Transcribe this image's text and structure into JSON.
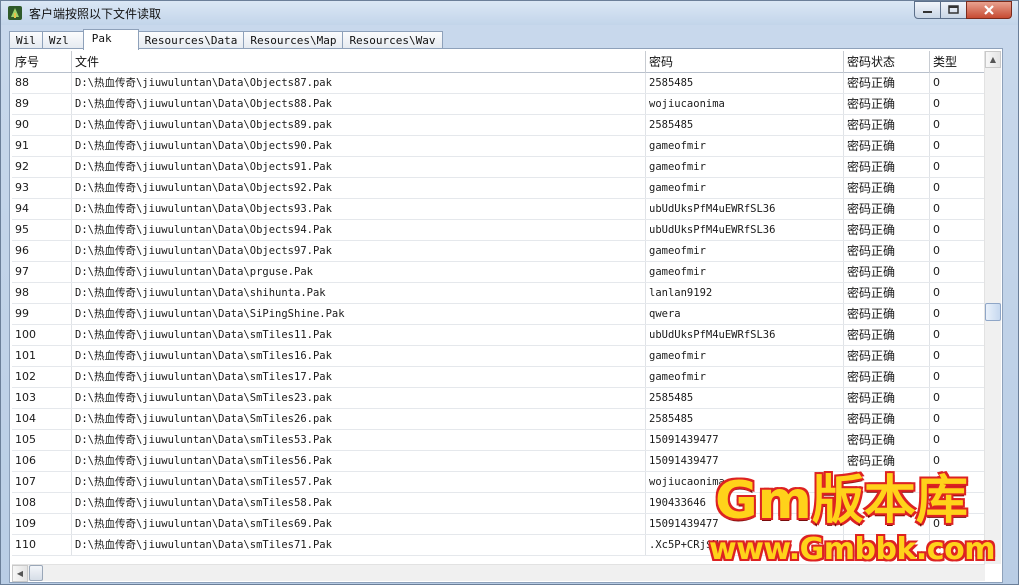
{
  "window": {
    "title": "客户端按照以下文件读取",
    "app_icon": "mir-legend-app-icon",
    "controls": [
      "minimize-icon",
      "maximize-icon",
      "close-icon"
    ]
  },
  "tabs": [
    {
      "label": "Wil",
      "active": false
    },
    {
      "label": "Wzl",
      "active": false
    },
    {
      "label": "Pak",
      "active": true
    },
    {
      "label": "Resources\\Data",
      "active": false
    },
    {
      "label": "Resources\\Map",
      "active": false
    },
    {
      "label": "Resources\\Wav",
      "active": false
    }
  ],
  "table": {
    "columns": [
      "序号",
      "文件",
      "密码",
      "密码状态",
      "类型"
    ],
    "rows": [
      [
        "88",
        "D:\\热血传奇\\jiuwuluntan\\Data\\Objects87.pak",
        "2585485",
        "密码正确",
        "0"
      ],
      [
        "89",
        "D:\\热血传奇\\jiuwuluntan\\Data\\Objects88.Pak",
        "wojiucaonima",
        "密码正确",
        "0"
      ],
      [
        "90",
        "D:\\热血传奇\\jiuwuluntan\\Data\\Objects89.pak",
        "2585485",
        "密码正确",
        "0"
      ],
      [
        "91",
        "D:\\热血传奇\\jiuwuluntan\\Data\\Objects90.Pak",
        "gameofmir",
        "密码正确",
        "0"
      ],
      [
        "92",
        "D:\\热血传奇\\jiuwuluntan\\Data\\Objects91.Pak",
        "gameofmir",
        "密码正确",
        "0"
      ],
      [
        "93",
        "D:\\热血传奇\\jiuwuluntan\\Data\\Objects92.Pak",
        "gameofmir",
        "密码正确",
        "0"
      ],
      [
        "94",
        "D:\\热血传奇\\jiuwuluntan\\Data\\Objects93.Pak",
        "ubUdUksPfM4uEWRfSL36",
        "密码正确",
        "0"
      ],
      [
        "95",
        "D:\\热血传奇\\jiuwuluntan\\Data\\Objects94.Pak",
        "ubUdUksPfM4uEWRfSL36",
        "密码正确",
        "0"
      ],
      [
        "96",
        "D:\\热血传奇\\jiuwuluntan\\Data\\Objects97.Pak",
        "gameofmir",
        "密码正确",
        "0"
      ],
      [
        "97",
        "D:\\热血传奇\\jiuwuluntan\\Data\\prguse.Pak",
        "gameofmir",
        "密码正确",
        "0"
      ],
      [
        "98",
        "D:\\热血传奇\\jiuwuluntan\\Data\\shihunta.Pak",
        "lanlan9192",
        "密码正确",
        "0"
      ],
      [
        "99",
        "D:\\热血传奇\\jiuwuluntan\\Data\\SiPingShine.Pak",
        "qwera",
        "密码正确",
        "0"
      ],
      [
        "100",
        "D:\\热血传奇\\jiuwuluntan\\Data\\smTiles11.Pak",
        "ubUdUksPfM4uEWRfSL36",
        "密码正确",
        "0"
      ],
      [
        "101",
        "D:\\热血传奇\\jiuwuluntan\\Data\\smTiles16.Pak",
        "gameofmir",
        "密码正确",
        "0"
      ],
      [
        "102",
        "D:\\热血传奇\\jiuwuluntan\\Data\\smTiles17.Pak",
        "gameofmir",
        "密码正确",
        "0"
      ],
      [
        "103",
        "D:\\热血传奇\\jiuwuluntan\\Data\\SmTiles23.pak",
        "2585485",
        "密码正确",
        "0"
      ],
      [
        "104",
        "D:\\热血传奇\\jiuwuluntan\\Data\\SmTiles26.pak",
        "2585485",
        "密码正确",
        "0"
      ],
      [
        "105",
        "D:\\热血传奇\\jiuwuluntan\\Data\\smTiles53.Pak",
        "15091439477",
        "密码正确",
        "0"
      ],
      [
        "106",
        "D:\\热血传奇\\jiuwuluntan\\Data\\smTiles56.Pak",
        "15091439477",
        "密码正确",
        "0"
      ],
      [
        "107",
        "D:\\热血传奇\\jiuwuluntan\\Data\\smTiles57.Pak",
        "wojiucaonima",
        "",
        "0"
      ],
      [
        "108",
        "D:\\热血传奇\\jiuwuluntan\\Data\\smTiles58.Pak",
        "190433646",
        "",
        "0"
      ],
      [
        "109",
        "D:\\热血传奇\\jiuwuluntan\\Data\\smTiles69.Pak",
        "15091439477",
        "",
        "0"
      ],
      [
        "110",
        "D:\\热血传奇\\jiuwuluntan\\Data\\smTiles71.Pak",
        ".Xc5P+CRj$N",
        "",
        "0"
      ]
    ]
  },
  "watermark": {
    "title": "Gm版本库",
    "url": "www.Gmbbk.com"
  },
  "colors": {
    "window_frame": "#b9cde5",
    "close_button": "#c74b32",
    "watermark_fill": "#ffd21a",
    "watermark_outline": "#dd2222"
  }
}
